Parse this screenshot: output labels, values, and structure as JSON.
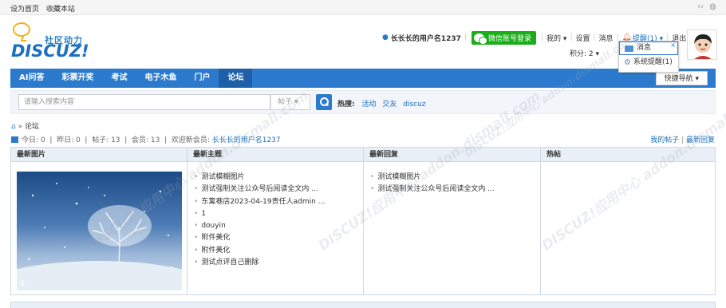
{
  "topbar": {
    "set_home": "设为首页",
    "bookmark": "收藏本站"
  },
  "logo": {
    "cn": "社区动力",
    "en": "DISCUZ!"
  },
  "userbar": {
    "username": "长长长的用户名1237",
    "wechat_login": "微信账号登录",
    "mine": "我的",
    "settings": "设置",
    "messages": "消息",
    "reminders": "提醒(1)",
    "logout": "退出",
    "score": "积分: 2"
  },
  "popup": {
    "messages": "消息",
    "system_reminder": "系统提醒(1)"
  },
  "nav": {
    "items": [
      "AI问答",
      "彩票开奖",
      "考试",
      "电子木鱼",
      "门户",
      "论坛"
    ],
    "active": "论坛",
    "quick_nav": "快捷导航"
  },
  "search": {
    "placeholder": "请输入搜索内容",
    "type": "帖子",
    "hot_label": "热搜:",
    "hot": [
      "活动",
      "交友",
      "discuz"
    ]
  },
  "breadcrumb": {
    "current": "论坛"
  },
  "stats": {
    "text": "今日: 0  |  昨日: 0  |  帖子: 13  |  会员: 13  |  欢迎新会员: ",
    "new_member": "长长长的用户名1237"
  },
  "mylinks": {
    "my_posts": "我的帖子",
    "latest_replies": "最新回复"
  },
  "columns": {
    "pictures": {
      "title": "最新图片",
      "image_index": "1"
    },
    "threads": {
      "title": "最新主题",
      "items": [
        "测试模糊图片",
        "测试强制关注公众号后阅读全文内 ...",
        "东篱巷店2023-04-19责任人admin ...",
        "1",
        "douyin",
        "附件美化",
        "附件美化",
        "测试点评自己删除"
      ]
    },
    "replies": {
      "title": "最新回复",
      "items": [
        "测试模糊图片",
        "测试强制关注公众号后阅读全文内 ..."
      ]
    },
    "hot": {
      "title": "热帖"
    }
  },
  "colors": {
    "nav": "#2b7acd",
    "nav_active": "#1f5fa8",
    "wechat": "#1aad19",
    "link": "#1a6fbf"
  },
  "watermark": {
    "text": "DISCUZ!应用中心 addon.dismall.com"
  }
}
